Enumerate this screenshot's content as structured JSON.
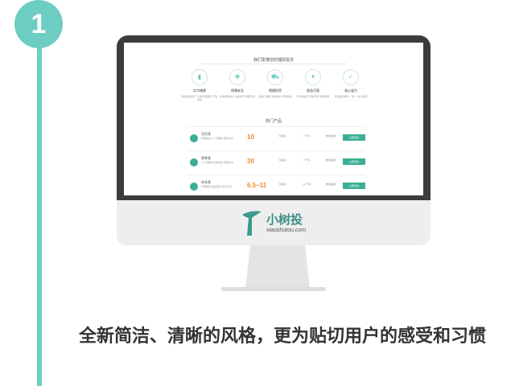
{
  "step": {
    "number": "1"
  },
  "screen": {
    "title": "我们更懂您的理财需求",
    "features": [
      {
        "icon": "chart-icon",
        "glyph": "▮",
        "title": "实力雄厚",
        "desc": "精选优质资产 专业风控团队 严选把关"
      },
      {
        "icon": "shield-icon",
        "glyph": "✚",
        "title": "保障安全",
        "desc": "多重保障体系 资金托管 保障无忧"
      },
      {
        "icon": "cart-icon",
        "glyph": "⛟",
        "title": "便捷投资",
        "desc": "起投门槛低 随时随地 轻松投资"
      },
      {
        "icon": "coin-icon",
        "glyph": "✦",
        "title": "收益可观",
        "desc": "年化收益高 稳健增值 按时回款"
      },
      {
        "icon": "check-icon",
        "glyph": "✓",
        "title": "省心省力",
        "desc": "专业团队服务 一对一 贴心客服"
      }
    ],
    "products_heading": "热门产品",
    "products": [
      {
        "name": "月月享",
        "desc": "稳健投资 1个月起投 按月付息",
        "rate": "10",
        "col1": "可投资",
        "col2": "1个月",
        "col3": "剩余金额",
        "button": "立即投资"
      },
      {
        "name": "季季享",
        "desc": "3个月期限 稳健收益 到期还本",
        "rate": "30",
        "col1": "可投资",
        "col2": "3个月",
        "col3": "剩余金额",
        "button": "立即投资"
      },
      {
        "name": "年年享",
        "desc": "长期理财 收益稳定 安全可靠",
        "rate": "6.5~11",
        "col1": "可投资",
        "col2": "12个月",
        "col3": "剩余金额",
        "button": "立即投资"
      }
    ]
  },
  "logo": {
    "cn": "小树投",
    "en": "xiaoshutou.com"
  },
  "caption": "全新简洁、清晰的风格，更为贴切用户的感受和习惯"
}
